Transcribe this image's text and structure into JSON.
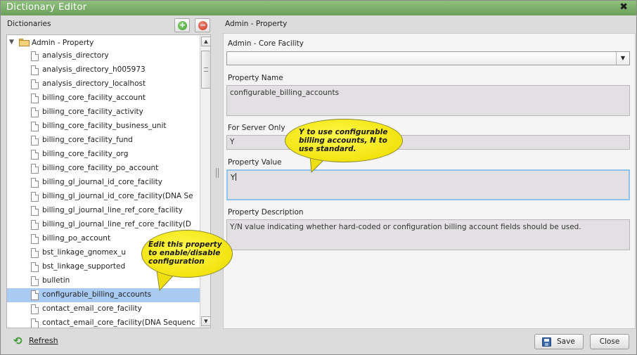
{
  "window": {
    "title": "Dictionary Editor"
  },
  "left": {
    "header": "Dictionaries",
    "root_label": "Admin - Property",
    "items": [
      "analysis_directory",
      "analysis_directory_h005973",
      "analysis_directory_localhost",
      "billing_core_facility_account",
      "billing_core_facility_activity",
      "billing_core_facility_business_unit",
      "billing_core_facility_fund",
      "billing_core_facility_org",
      "billing_core_facility_po_account",
      "billing_gl_journal_id_core_facility",
      "billing_gl_journal_id_core_facility(DNA Se",
      "billing_gl_journal_line_ref_core_facility",
      "billing_gl_journal_line_ref_core_facility(D",
      "billing_po_account",
      "bst_linkage_gnomex_u",
      "bst_linkage_supported",
      "bulletin",
      "configurable_billing_accounts",
      "contact_email_core_facility",
      "contact_email_core_facility(DNA Sequenc"
    ],
    "selected_index": 17,
    "refresh_label": "Refresh"
  },
  "right": {
    "header": "Admin - Property",
    "core_facility_label": "Admin - Core Facility",
    "core_facility_value": "",
    "property_name_label": "Property Name",
    "property_name_value": "configurable_billing_accounts",
    "for_server_only_label": "For Server Only",
    "for_server_only_value": "Y",
    "property_value_label": "Property Value",
    "property_value_value": "Y",
    "property_description_label": "Property Description",
    "property_description_value": "Y/N value indicating whether hard-coded or configuration billing account fields should be used."
  },
  "buttons": {
    "save_label": "Save",
    "close_label": "Close"
  },
  "callouts": {
    "property_value_note": [
      "Y to use configurable",
      "billing accounts, N to",
      "use standard."
    ],
    "edit_note": [
      "Edit this property",
      "to enable/disable",
      "configuration"
    ]
  },
  "icons": {
    "close": "close-icon",
    "add": "add-icon",
    "remove": "remove-icon",
    "folder": "folder-icon",
    "document": "document-icon",
    "refresh": "refresh-icon",
    "save": "save-icon"
  },
  "colors": {
    "titlebar": "#7aae68",
    "selection": "#a9cbf2",
    "callout": "#f5e61a",
    "focus_border": "#8fc3ea"
  }
}
